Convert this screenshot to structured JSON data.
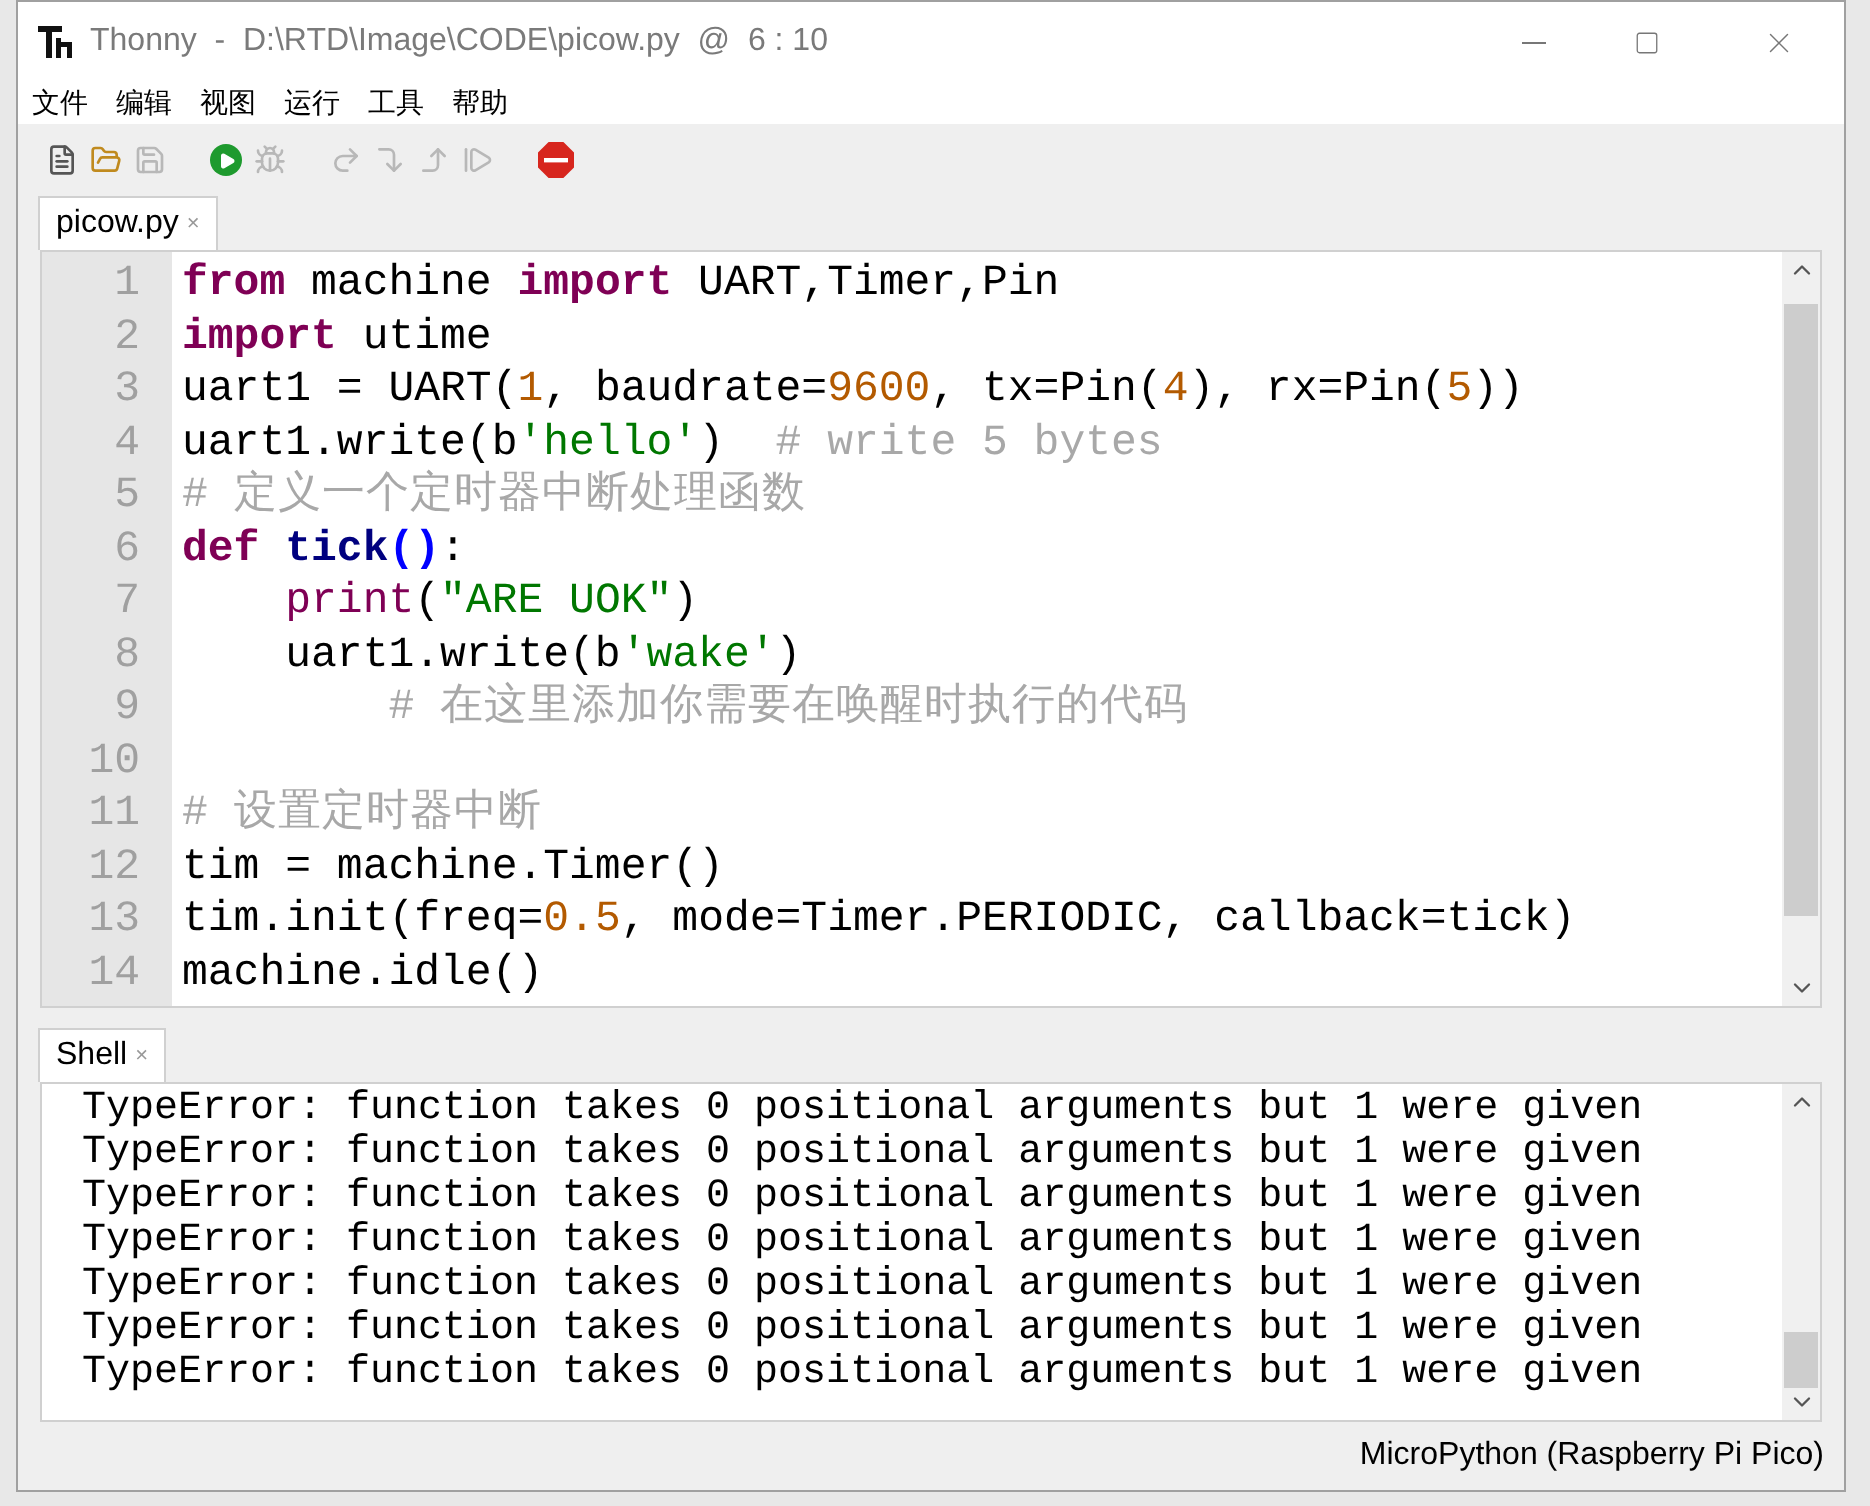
{
  "window": {
    "title": "Thonny  -  D:\\RTD\\Image\\CODE\\picow.py  @  6 : 10"
  },
  "menu": [
    "文件",
    "编辑",
    "视图",
    "运行",
    "工具",
    "帮助"
  ],
  "toolbar": [
    {
      "kind": "new",
      "disabled": false
    },
    {
      "kind": "open",
      "disabled": false
    },
    {
      "kind": "save",
      "disabled": true
    },
    {
      "kind": "run",
      "disabled": false
    },
    {
      "kind": "debug",
      "disabled": true
    },
    {
      "kind": "step-over",
      "disabled": true
    },
    {
      "kind": "step-into",
      "disabled": true
    },
    {
      "kind": "step-out",
      "disabled": true
    },
    {
      "kind": "resume",
      "disabled": true
    },
    {
      "kind": "stop",
      "disabled": false
    }
  ],
  "editor_tabs": [
    {
      "label": "picow.py",
      "close": "×",
      "selected": true
    }
  ],
  "code": [
    {
      "number": "1",
      "tokens": [
        {
          "text": "from",
          "kind": "keyword"
        },
        {
          "text": " machine ",
          "kind": "plain"
        },
        {
          "text": "import",
          "kind": "keyword"
        },
        {
          "text": " UART,Timer,Pin",
          "kind": "plain"
        }
      ]
    },
    {
      "number": "2",
      "tokens": [
        {
          "text": "import",
          "kind": "keyword"
        },
        {
          "text": " utime",
          "kind": "plain"
        }
      ]
    },
    {
      "number": "3",
      "tokens": [
        {
          "text": "uart1 = UART(",
          "kind": "plain"
        },
        {
          "text": "1",
          "kind": "number"
        },
        {
          "text": ", baudrate=",
          "kind": "plain"
        },
        {
          "text": "9600",
          "kind": "number"
        },
        {
          "text": ", tx=Pin(",
          "kind": "plain"
        },
        {
          "text": "4",
          "kind": "number"
        },
        {
          "text": "), rx=Pin(",
          "kind": "plain"
        },
        {
          "text": "5",
          "kind": "number"
        },
        {
          "text": "))",
          "kind": "plain"
        }
      ]
    },
    {
      "number": "4",
      "tokens": [
        {
          "text": "uart1.write(b",
          "kind": "plain"
        },
        {
          "text": "'hello'",
          "kind": "string"
        },
        {
          "text": ")  ",
          "kind": "plain"
        },
        {
          "text": "# write 5 bytes",
          "kind": "comment"
        }
      ]
    },
    {
      "number": "5",
      "tokens": [
        {
          "text": "# 定义一个定时器中断处理函数",
          "kind": "comment"
        }
      ]
    },
    {
      "number": "6",
      "tokens": [
        {
          "text": "def ",
          "kind": "keyword"
        },
        {
          "text": "tick",
          "kind": "definition"
        },
        {
          "text": "()",
          "kind": "paren"
        },
        {
          "text": ":",
          "kind": "plain"
        }
      ]
    },
    {
      "number": "7",
      "tokens": [
        {
          "text": "    print",
          "kind": "builtin"
        },
        {
          "text": "(",
          "kind": "plain"
        },
        {
          "text": "\"ARE UOK\"",
          "kind": "string"
        },
        {
          "text": ")",
          "kind": "plain"
        }
      ]
    },
    {
      "number": "8",
      "tokens": [
        {
          "text": "    uart1.write(b",
          "kind": "plain"
        },
        {
          "text": "'wake'",
          "kind": "string"
        },
        {
          "text": ")",
          "kind": "plain"
        }
      ]
    },
    {
      "number": "9",
      "tokens": [
        {
          "text": "        # 在这里添加你需要在唤醒时执行的代码",
          "kind": "comment"
        }
      ]
    },
    {
      "number": "10"
    },
    {
      "number": "11",
      "tokens": [
        {
          "text": "# 设置定时器中断",
          "kind": "comment"
        }
      ]
    },
    {
      "number": "12",
      "tokens": [
        {
          "text": "tim = machine.Timer()",
          "kind": "plain"
        }
      ]
    },
    {
      "number": "13",
      "tokens": [
        {
          "text": "tim.init(freq=",
          "kind": "plain"
        },
        {
          "text": "0.5",
          "kind": "number"
        },
        {
          "text": ", mode=Timer.PERIODIC, callback=tick)",
          "kind": "plain"
        }
      ]
    },
    {
      "number": "14",
      "tokens": [
        {
          "text": "machine.idle()",
          "kind": "plain"
        }
      ]
    }
  ],
  "shell_tabs": [
    {
      "label": "Shell",
      "close": "×",
      "selected": true
    }
  ],
  "shell_lines": [
    "TypeError: function takes 0 positional arguments but 1 were given",
    "TypeError: function takes 0 positional arguments but 1 were given",
    "TypeError: function takes 0 positional arguments but 1 were given",
    "TypeError: function takes 0 positional arguments but 1 were given",
    "TypeError: function takes 0 positional arguments but 1 were given",
    "TypeError: function takes 0 positional arguments but 1 were given",
    "TypeError: function takes 0 positional arguments but 1 were given"
  ],
  "status_bar": {
    "interpreter": "MicroPython (Raspberry Pi Pico)"
  }
}
